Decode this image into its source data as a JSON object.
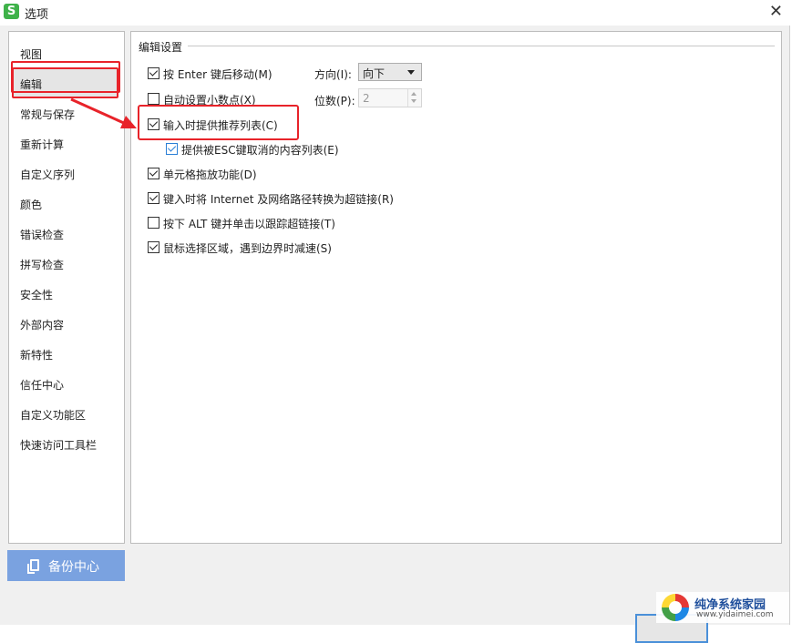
{
  "window": {
    "title": "选项",
    "app_icon_letter": "S",
    "close_symbol": "✕"
  },
  "sidebar": {
    "items": [
      {
        "label": "视图"
      },
      {
        "label": "编辑",
        "selected": true
      },
      {
        "label": "常规与保存"
      },
      {
        "label": "重新计算"
      },
      {
        "label": "自定义序列"
      },
      {
        "label": "颜色"
      },
      {
        "label": "错误检查"
      },
      {
        "label": "拼写检查"
      },
      {
        "label": "安全性"
      },
      {
        "label": "外部内容"
      },
      {
        "label": "新特性"
      },
      {
        "label": "信任中心"
      },
      {
        "label": "自定义功能区"
      },
      {
        "label": "快速访问工具栏"
      }
    ],
    "backup_label": "备份中心"
  },
  "main": {
    "section_title": "编辑设置",
    "options": [
      {
        "label": "按 Enter 键后移动(M)",
        "checked": true
      },
      {
        "label": "自动设置小数点(X)",
        "checked": false
      },
      {
        "label": "输入时提供推荐列表(C)",
        "checked": true
      },
      {
        "label": "提供被ESC键取消的内容列表(E)",
        "checked": true
      },
      {
        "label": "单元格拖放功能(D)",
        "checked": true
      },
      {
        "label": "键入时将 Internet 及网络路径转换为超链接(R)",
        "checked": true
      },
      {
        "label": "按下 ALT 键并单击以跟踪超链接(T)",
        "checked": false
      },
      {
        "label": "鼠标选择区域，遇到边界时减速(S)",
        "checked": true
      }
    ],
    "direction_label": "方向(I):",
    "direction_value": "向下",
    "digits_label": "位数(P):",
    "digits_value": "2"
  },
  "colors": {
    "highlight_red": "#e8232a",
    "backup_button_blue": "#7aa2e0",
    "checkbox_blue": "#2b7fd6"
  },
  "watermark": {
    "title": "纯净系统家园",
    "url": "www.yidaimei.com"
  }
}
